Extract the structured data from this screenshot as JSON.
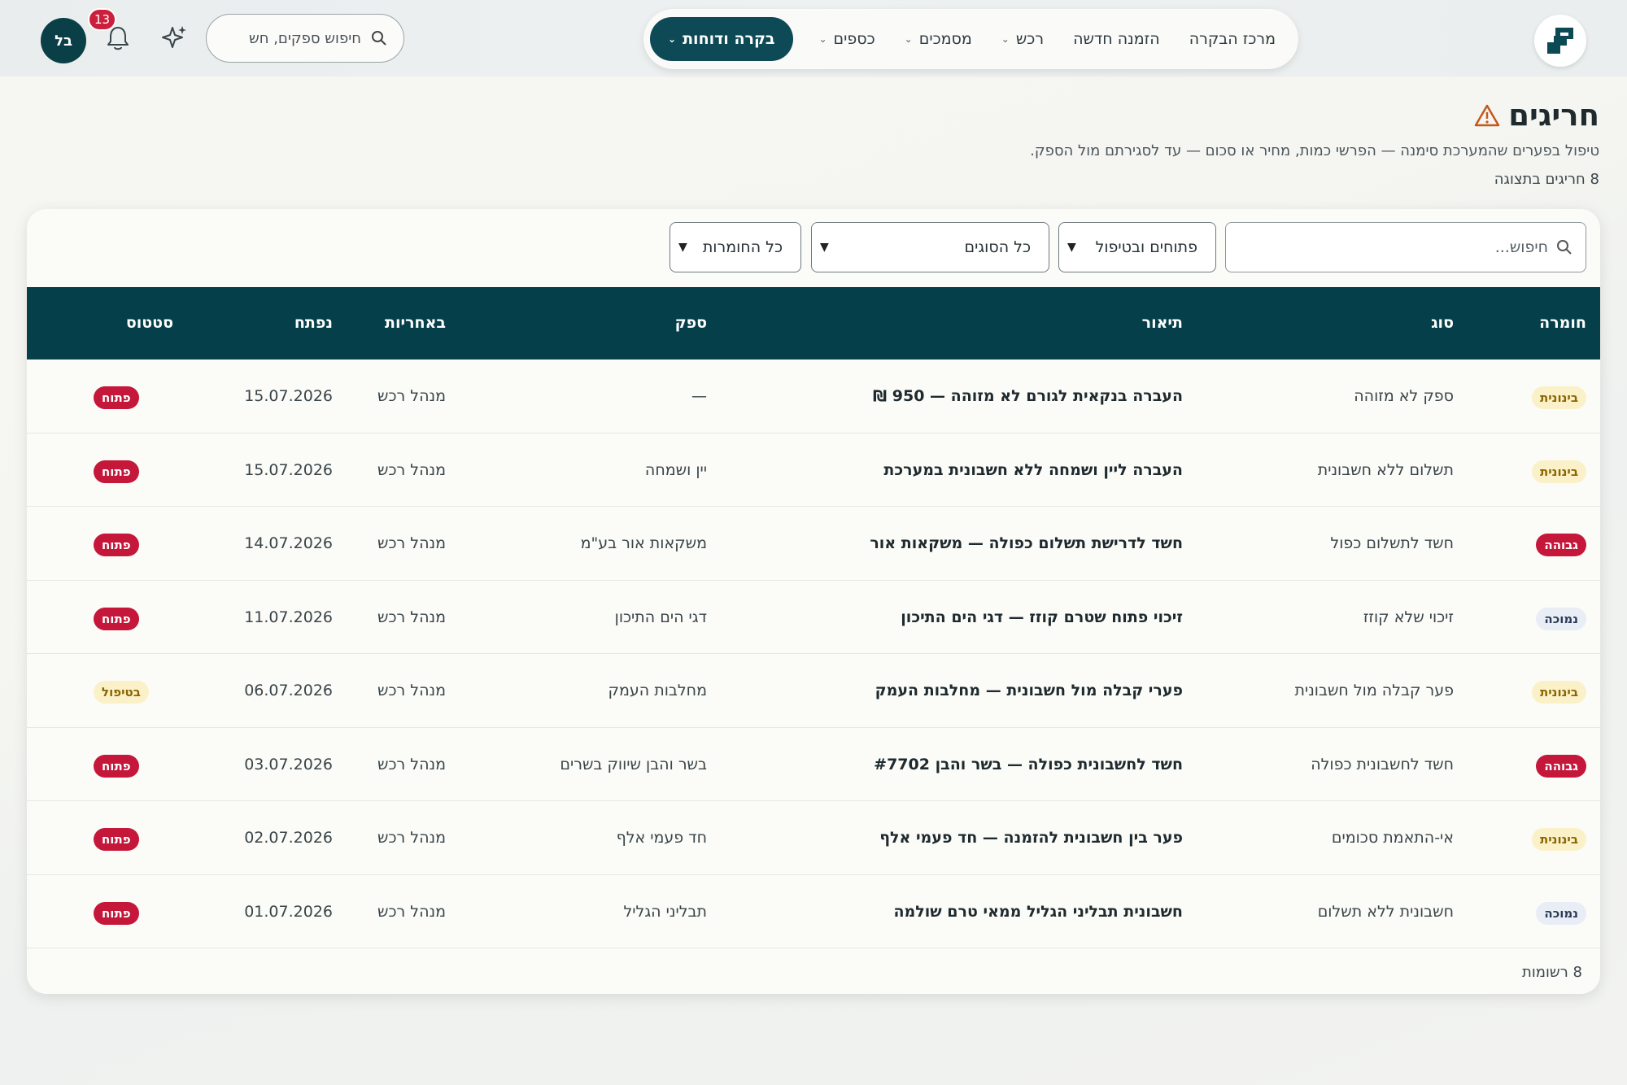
{
  "nav": {
    "items": [
      {
        "label": "מרכז הבקרה",
        "has_chevron": false
      },
      {
        "label": "הזמנה חדשה",
        "has_chevron": false
      },
      {
        "label": "רכש",
        "has_chevron": true
      },
      {
        "label": "מסמכים",
        "has_chevron": true
      },
      {
        "label": "כספים",
        "has_chevron": true
      },
      {
        "label": "בקרה ודוחות",
        "has_chevron": true,
        "active": true
      }
    ]
  },
  "header": {
    "search_placeholder": "חיפוש ספקים, חש",
    "notifications_count": "13",
    "avatar_initials": "בל"
  },
  "page": {
    "title": "חריגים",
    "subtitle": "טיפול בפערים שהמערכת סימנה — הפרשי כמות, מחיר או סכום — עד לסגירתם מול הספק.",
    "count_line": "8 חריגים בתצוגה"
  },
  "filters": {
    "search_placeholder": "חיפוש...",
    "status_value": "פתוחים ובטיפול",
    "type_value": "כל הסוגים",
    "severity_value": "כל החומרות"
  },
  "table": {
    "headers": {
      "severity": "חומרה",
      "type": "סוג",
      "description": "תיאור",
      "supplier": "ספק",
      "owner": "באחריות",
      "opened": "נפתח",
      "status": "סטטוס"
    },
    "rows": [
      {
        "severity": "בינונית",
        "sev_level": "med",
        "type": "ספק לא מזוהה",
        "description": "העברה בנקאית לגורם לא מזוהה — 950 ₪",
        "supplier": "—",
        "owner": "מנהל רכש",
        "opened": "15.07.2026",
        "status": "פתוח",
        "status_kind": "open"
      },
      {
        "severity": "בינונית",
        "sev_level": "med",
        "type": "תשלום ללא חשבונית",
        "description": "העברה ליין ושמחה ללא חשבונית במערכת",
        "supplier": "יין ושמחה",
        "owner": "מנהל רכש",
        "opened": "15.07.2026",
        "status": "פתוח",
        "status_kind": "open"
      },
      {
        "severity": "גבוהה",
        "sev_level": "high",
        "type": "חשד לתשלום כפול",
        "description": "חשד לדרישת תשלום כפולה — משקאות אור",
        "supplier": "משקאות אור בע\"מ",
        "owner": "מנהל רכש",
        "opened": "14.07.2026",
        "status": "פתוח",
        "status_kind": "open"
      },
      {
        "severity": "נמוכה",
        "sev_level": "low",
        "type": "זיכוי שלא קוזז",
        "description": "זיכוי פתוח שטרם קוזז — דגי הים התיכון",
        "supplier": "דגי הים התיכון",
        "owner": "מנהל רכש",
        "opened": "11.07.2026",
        "status": "פתוח",
        "status_kind": "open"
      },
      {
        "severity": "בינונית",
        "sev_level": "med",
        "type": "פער קבלה מול חשבונית",
        "description": "פערי קבלה מול חשבונית — מחלבות העמק",
        "supplier": "מחלבות העמק",
        "owner": "מנהל רכש",
        "opened": "06.07.2026",
        "status": "בטיפול",
        "status_kind": "work"
      },
      {
        "severity": "גבוהה",
        "sev_level": "high",
        "type": "חשד לחשבונית כפולה",
        "description": "חשד לחשבונית כפולה — בשר והבן #7702",
        "supplier": "בשר והבן שיווק בשרים",
        "owner": "מנהל רכש",
        "opened": "03.07.2026",
        "status": "פתוח",
        "status_kind": "open"
      },
      {
        "severity": "בינונית",
        "sev_level": "med",
        "type": "אי-התאמת סכומים",
        "description": "פער בין חשבונית להזמנה — חד פעמי אלף",
        "supplier": "חד פעמי אלף",
        "owner": "מנהל רכש",
        "opened": "02.07.2026",
        "status": "פתוח",
        "status_kind": "open"
      },
      {
        "severity": "נמוכה",
        "sev_level": "low",
        "type": "חשבונית ללא תשלום",
        "description": "חשבונית תבליני הגליל ממאי טרם שולמה",
        "supplier": "תבליני הגליל",
        "owner": "מנהל רכש",
        "opened": "01.07.2026",
        "status": "פתוח",
        "status_kind": "open"
      }
    ]
  },
  "footer": {
    "records_count": "8 רשומות"
  },
  "colors": {
    "primary": "#053f4a",
    "danger": "#c4173a",
    "warning_bg": "#fbf1c8",
    "low_bg": "#e9eef6"
  },
  "icons": {
    "logo": "logo-icon",
    "search": "search-icon",
    "sparkle": "sparkle-icon",
    "bell": "bell-icon",
    "warning": "warning-icon",
    "chevron": "chevron-down-icon"
  }
}
